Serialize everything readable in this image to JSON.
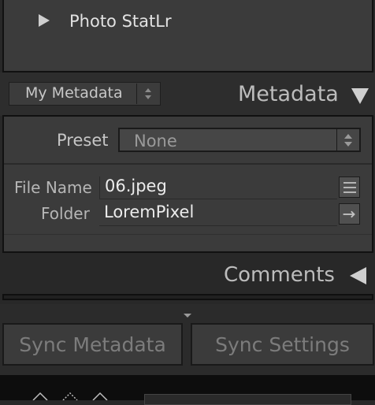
{
  "plugin_panel": {
    "label": "Photo StatLr",
    "arrow_icon": "triangle-right-icon"
  },
  "metadata_header": {
    "set_selector": "My Metadata",
    "title": "Metadata",
    "collapse_icon": "triangle-down-icon"
  },
  "preset": {
    "label": "Preset",
    "value": "None"
  },
  "fields": {
    "file_name": {
      "label": "File Name",
      "value": "06.jpeg"
    },
    "folder": {
      "label": "Folder",
      "value": "LoremPixel"
    }
  },
  "comments": {
    "title": "Comments",
    "expand_icon": "triangle-left-icon"
  },
  "buttons": {
    "sync_metadata": "Sync Metadata",
    "sync_settings": "Sync Settings"
  },
  "colors": {
    "panel": "#3b3b3b",
    "background": "#282828",
    "text": "#c8c8c8"
  }
}
